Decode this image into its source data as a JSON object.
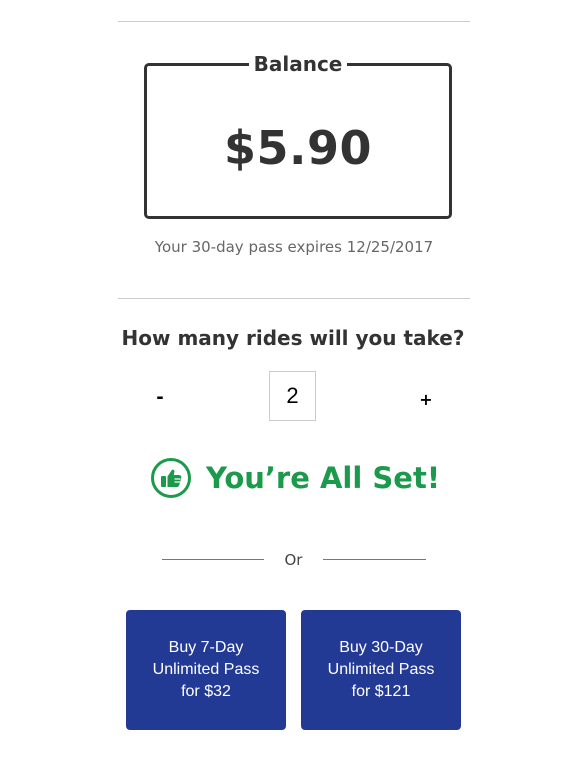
{
  "balance": {
    "label": "Balance",
    "amount": "$5.90",
    "expiry_text": "Your 30-day pass expires 12/25/2017"
  },
  "rides": {
    "question": "How many rides will you take?",
    "decrement_label": "-",
    "increment_label": "+",
    "count": "2"
  },
  "status": {
    "message": "You’re All Set!",
    "icon": "thumbs-up-icon",
    "color": "#1b9a4b"
  },
  "divider": {
    "or_label": "Or"
  },
  "passes": [
    {
      "line1": "Buy 7-Day",
      "line2": "Unlimited Pass",
      "line3": "for $32"
    },
    {
      "line1": "Buy 30-Day",
      "line2": "Unlimited Pass",
      "line3": "for $121"
    }
  ],
  "colors": {
    "button_bg": "#223a94",
    "text": "#333333",
    "success": "#1b9a4b"
  }
}
